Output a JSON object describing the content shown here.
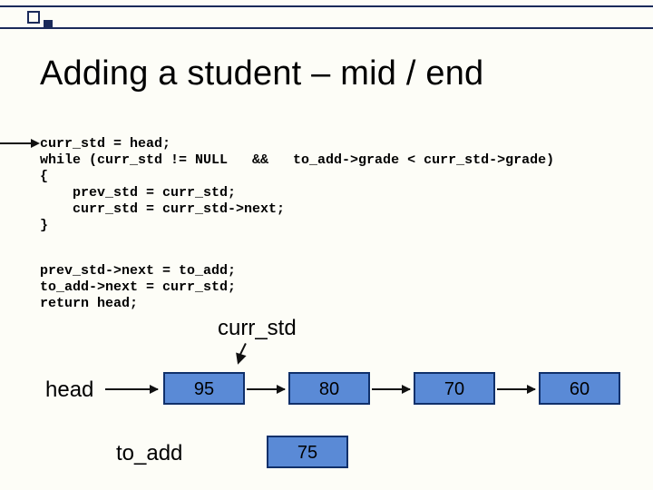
{
  "title": "Adding a student – mid / end",
  "code_block_1": "curr_std = head;\nwhile (curr_std != NULL   &&   to_add->grade < curr_std->grade)\n{\n    prev_std = curr_std;\n    curr_std = curr_std->next;\n}",
  "code_block_2": "prev_std->next = to_add;\nto_add->next = curr_std;\nreturn head;",
  "labels": {
    "curr": "curr_std",
    "head": "head",
    "to_add": "to_add"
  },
  "list_nodes": [
    "95",
    "80",
    "70",
    "60"
  ],
  "insert_node": "75"
}
